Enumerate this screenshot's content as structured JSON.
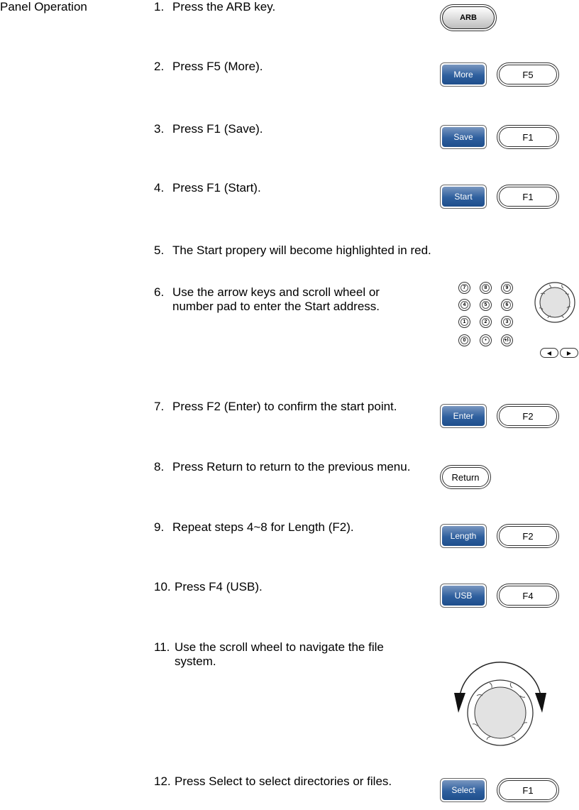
{
  "section_label": "Panel Operation",
  "steps": [
    {
      "num": "1.",
      "text": "Press the ARB key."
    },
    {
      "num": "2.",
      "text": "Press F5 (More)."
    },
    {
      "num": "3.",
      "text": "Press F1 (Save)."
    },
    {
      "num": "4.",
      "text": "Press F1 (Start)."
    },
    {
      "num": "5.",
      "text": "The Start propery will become highlighted in red."
    },
    {
      "num": "6.",
      "text": "Use the arrow keys and scroll wheel or number pad to enter the Start address."
    },
    {
      "num": "7.",
      "text": "Press F2 (Enter) to confirm the start point."
    },
    {
      "num": "8.",
      "text": "Press Return to return to the previous menu."
    },
    {
      "num": "9.",
      "text": "Repeat steps 4~8 for Length (F2)."
    },
    {
      "num": "10.",
      "text": "Press F4 (USB)."
    },
    {
      "num": "11.",
      "text": "Use the scroll wheel to navigate the file system."
    },
    {
      "num": "12.",
      "text": "Press Select to select directories or files."
    }
  ],
  "keys": {
    "arb": "ARB",
    "more": "More",
    "f5": "F5",
    "save": "Save",
    "f1_save": "F1",
    "start": "Start",
    "f1_start": "F1",
    "enter": "Enter",
    "f2_enter": "F2",
    "return": "Return",
    "length": "Length",
    "f2_length": "F2",
    "usb": "USB",
    "f4": "F4",
    "select": "Select",
    "f1_select": "F1"
  },
  "keypad": [
    "7",
    "8",
    "9",
    "4",
    "5",
    "6",
    "1",
    "2",
    "3",
    "0",
    "•",
    "+/-"
  ],
  "colors": {
    "softkey_blue": "#2e5f9e"
  }
}
